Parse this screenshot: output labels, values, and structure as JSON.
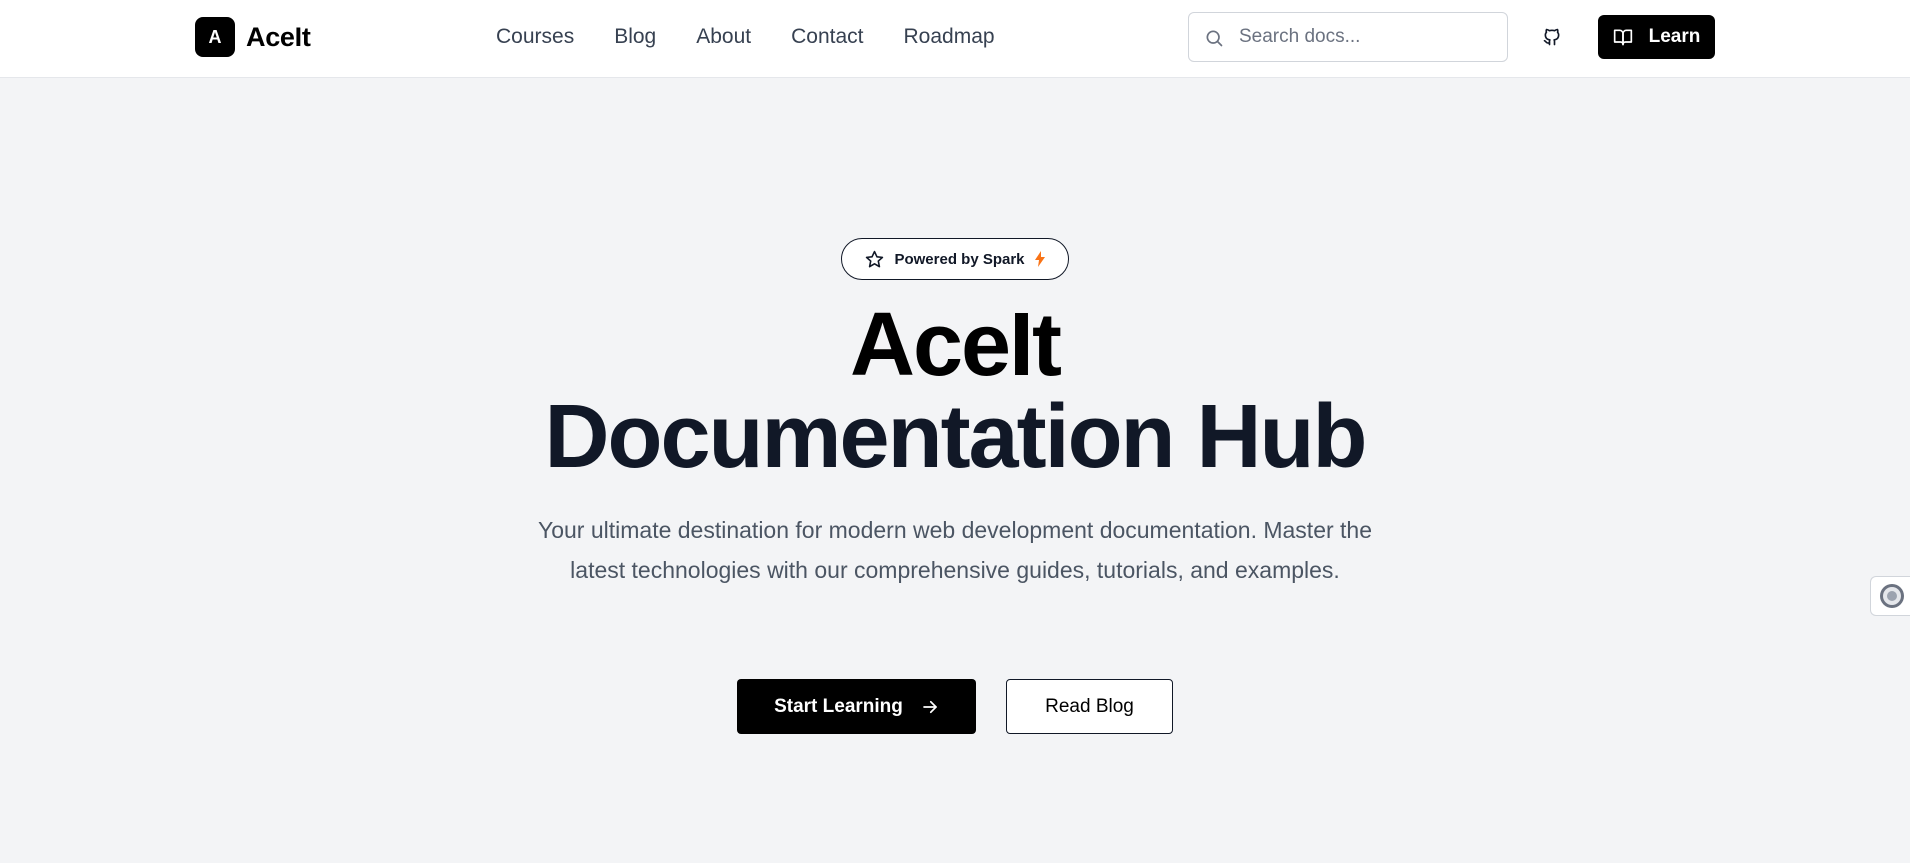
{
  "brand": {
    "mark": "A",
    "name": "AceIt"
  },
  "nav": {
    "links": [
      {
        "label": "Courses"
      },
      {
        "label": "Blog"
      },
      {
        "label": "About"
      },
      {
        "label": "Contact"
      },
      {
        "label": "Roadmap"
      }
    ]
  },
  "search": {
    "placeholder": "Search docs...",
    "value": "",
    "icon": "search-icon"
  },
  "header_actions": {
    "github_icon": "github-icon",
    "learn_label": "Learn",
    "learn_icon": "book-open-icon"
  },
  "hero": {
    "badge": {
      "label": "Powered by Spark",
      "icon": "star-icon",
      "accent_icon": "lightning-icon",
      "accent_color": "#f97316"
    },
    "title_line1": "AceIt",
    "title_line2": "Documentation Hub",
    "subtitle": "Your ultimate destination for modern web development documentation. Master the latest technologies with our comprehensive guides, tutorials, and examples.",
    "primary_cta": "Start Learning",
    "primary_cta_icon": "arrow-right-icon",
    "secondary_cta": "Read Blog"
  },
  "side_widget": {
    "icon": "accessibility-icon"
  },
  "colors": {
    "background": "#f3f4f6",
    "header_bg": "#ffffff",
    "primary": "#000000",
    "text": "#111827",
    "muted": "#4b5563"
  }
}
